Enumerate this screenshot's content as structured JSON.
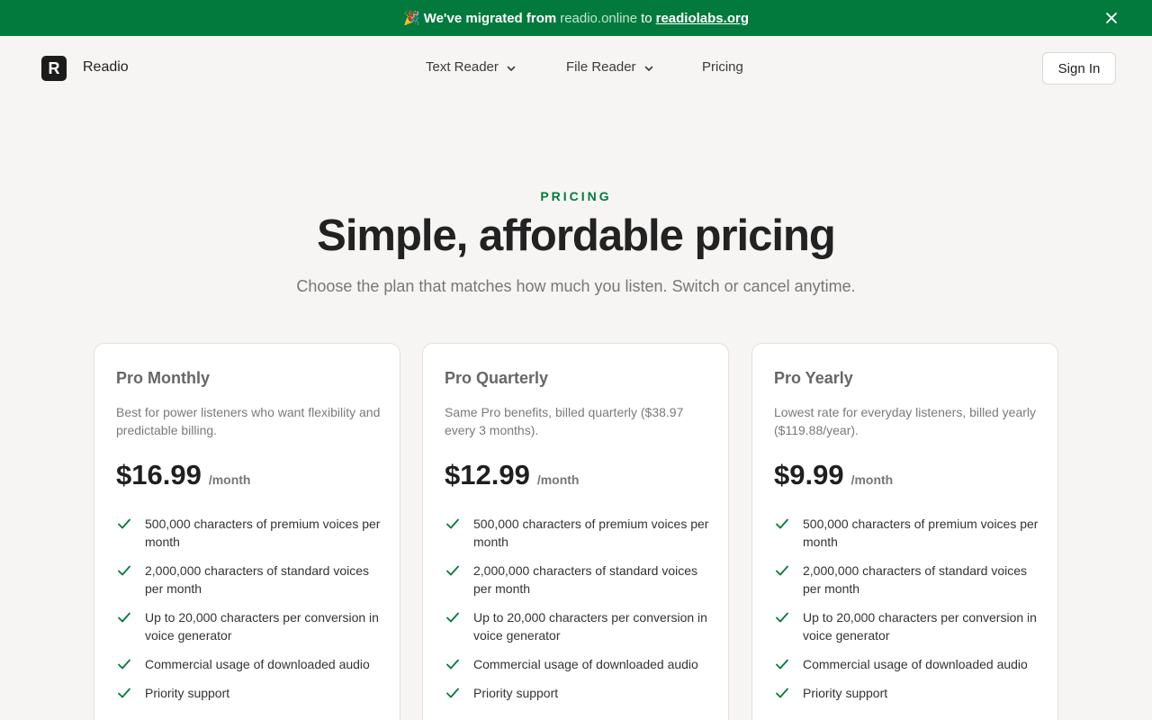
{
  "banner": {
    "emoji": "🎉",
    "lead": "We've migrated from",
    "old_domain": "readio.online",
    "to": "to",
    "new_domain": "readiolabs.org"
  },
  "header": {
    "logo_letter": "R",
    "brand": "Readio",
    "nav": {
      "text_reader": "Text Reader",
      "file_reader": "File Reader",
      "pricing": "Pricing"
    },
    "sign_in": "Sign In"
  },
  "hero": {
    "eyebrow": "PRICING",
    "title": "Simple, affordable pricing",
    "subtitle": "Choose the plan that matches how much you listen. Switch or cancel anytime."
  },
  "plans": [
    {
      "name": "Pro Monthly",
      "description": "Best for power listeners who want flexibility and predictable billing.",
      "price": "$16.99",
      "period": "/month",
      "features": [
        "500,000 characters of premium voices per month",
        "2,000,000 characters of standard voices per month",
        "Up to 20,000 characters per conversion in voice generator",
        "Commercial usage of downloaded audio",
        "Priority support"
      ]
    },
    {
      "name": "Pro Quarterly",
      "description": "Same Pro benefits, billed quarterly ($38.97 every 3 months).",
      "price": "$12.99",
      "period": "/month",
      "features": [
        "500,000 characters of premium voices per month",
        "2,000,000 characters of standard voices per month",
        "Up to 20,000 characters per conversion in voice generator",
        "Commercial usage of downloaded audio",
        "Priority support"
      ]
    },
    {
      "name": "Pro Yearly",
      "description": "Lowest rate for everyday listeners, billed yearly ($119.88/year).",
      "price": "$9.99",
      "period": "/month",
      "features": [
        "500,000 characters of premium voices per month",
        "2,000,000 characters of standard voices per month",
        "Up to 20,000 characters per conversion in voice generator",
        "Commercial usage of downloaded audio",
        "Priority support"
      ]
    }
  ],
  "colors": {
    "brand_green": "#027a3d",
    "background": "#f6f5f3",
    "card": "#ffffff"
  },
  "icons": {
    "banner_close": "close-icon",
    "nav_dropdown": "chevron-down-icon",
    "feature": "check-icon"
  }
}
